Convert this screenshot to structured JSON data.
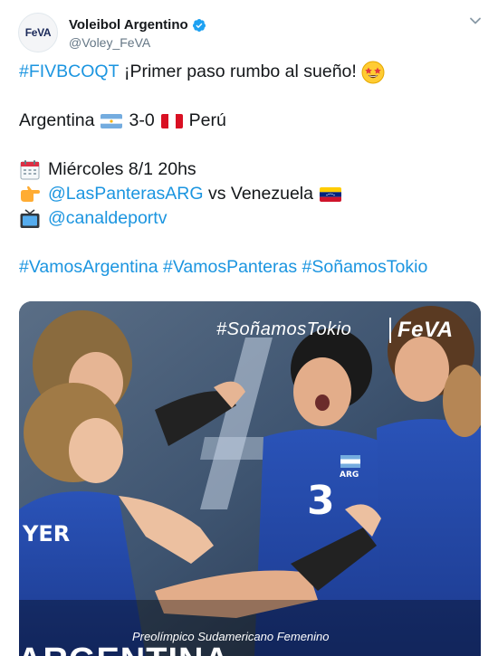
{
  "account": {
    "name": "Voleibol Argentino",
    "handle": "@Voley_FeVA",
    "avatar_text": "FeVA",
    "verified": true
  },
  "tweet": {
    "line1_tag": "#FIVBCOQT",
    "line1_text": "¡Primer paso rumbo al sueño!",
    "score_team1": "Argentina",
    "score": "3-0",
    "score_team2": "Perú",
    "date_text": "Miércoles 8/1 20hs",
    "match_mention": "@LasPanterasARG",
    "match_text": "vs Venezuela",
    "tv_mention": "@canaldeportv",
    "hashtags": [
      "#VamosArgentina",
      "#VamosPanteras",
      "#SoñamosTokio"
    ]
  },
  "media": {
    "hashtag": "#SoñamosTokio",
    "logo": "FeVA",
    "caption": "Preolímpico Sudamericano Femenino",
    "title": "ARGENTINA",
    "jersey_number": "3",
    "jersey_text": "ARG",
    "jersey_name": "YER"
  },
  "icons": {
    "emoji": "star-struck-icon",
    "calendar": "calendar-icon",
    "pointing": "pointing-right-icon",
    "tv": "television-icon",
    "caret": "chevron-down-icon"
  },
  "colors": {
    "link": "#1b95e0",
    "verified": "#1da1f2",
    "text": "#14171a",
    "muted": "#657786"
  }
}
